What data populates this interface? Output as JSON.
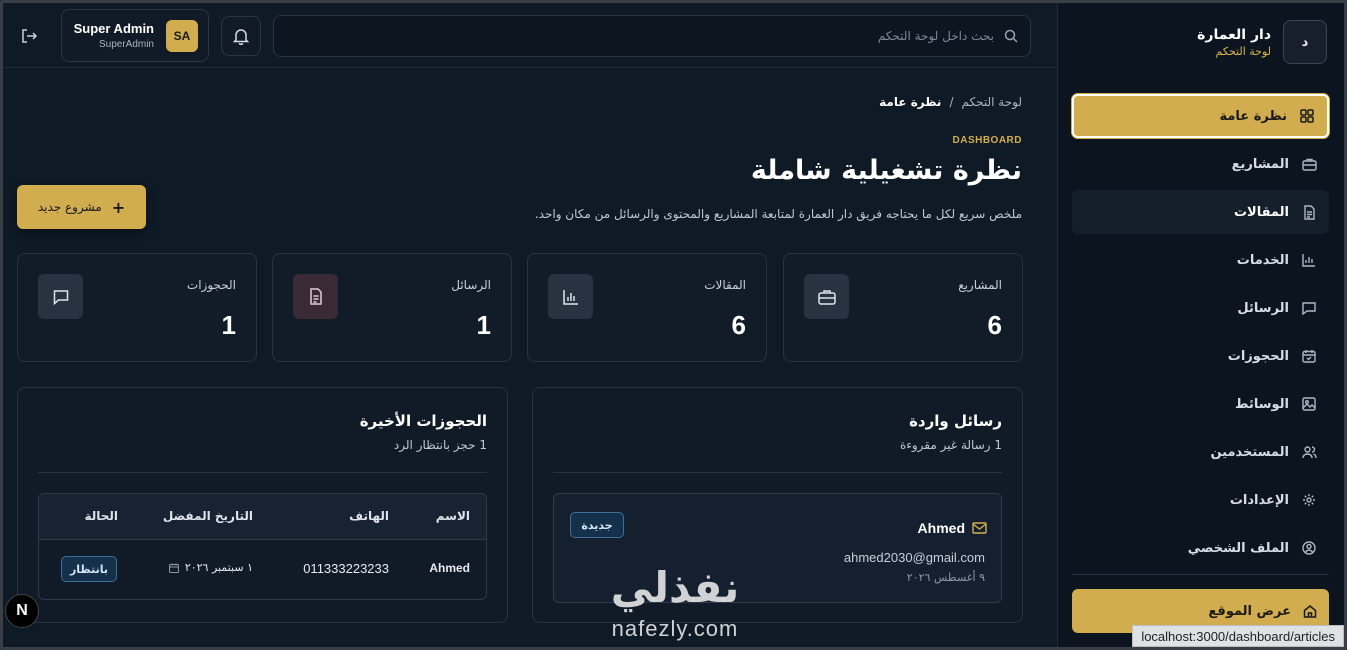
{
  "brand": {
    "title": "دار العمارة",
    "subtitle": "لوحة التحكم",
    "logo_letter": "د"
  },
  "sidebar": {
    "items": [
      {
        "label": "نظرة عامة",
        "icon": "grid-icon",
        "state": "active"
      },
      {
        "label": "المشاريع",
        "icon": "briefcase-icon"
      },
      {
        "label": "المقالات",
        "icon": "file-text-icon",
        "state": "hover"
      },
      {
        "label": "الخدمات",
        "icon": "bar-chart-icon"
      },
      {
        "label": "الرسائل",
        "icon": "message-square-icon"
      },
      {
        "label": "الحجوزات",
        "icon": "calendar-icon"
      },
      {
        "label": "الوسائط",
        "icon": "image-icon"
      },
      {
        "label": "المستخدمين",
        "icon": "users-icon"
      },
      {
        "label": "الإعدادات",
        "icon": "settings-icon"
      },
      {
        "label": "الملف الشخصي",
        "icon": "user-circle-icon"
      }
    ],
    "view_site_label": "عرض الموقع"
  },
  "topbar": {
    "search_placeholder": "بحث داخل لوحة التحكم",
    "user": {
      "name": "Super Admin",
      "role": "SuperAdmin",
      "initials": "SA"
    }
  },
  "breadcrumb": {
    "root": "لوحة التحكم",
    "separator": "/",
    "current": "نظرة عامة"
  },
  "header": {
    "eyebrow": "DASHBOARD",
    "title": "نظرة تشغيلية شاملة",
    "subtitle": "ملخص سريع لكل ما يحتاجه فريق دار العمارة لمتابعة المشاريع والمحتوى والرسائل من مكان واحد.",
    "new_project_label": "مشروع جديد"
  },
  "stats": [
    {
      "label": "المشاريع",
      "value": "6",
      "icon": "briefcase-icon"
    },
    {
      "label": "المقالات",
      "value": "6",
      "icon": "bar-chart-icon"
    },
    {
      "label": "الرسائل",
      "value": "1",
      "icon": "file-text-icon"
    },
    {
      "label": "الحجوزات",
      "value": "1",
      "icon": "message-square-icon"
    }
  ],
  "messages_panel": {
    "title": "رسائل واردة",
    "subtitle": "1 رسالة غير مقروءة",
    "message": {
      "name": "Ahmed",
      "email": "ahmed2030@gmail.com",
      "date": "٩ أغسطس ٢٠٢٦",
      "badge": "جديدة"
    }
  },
  "bookings_panel": {
    "title": "الحجوزات الأخيرة",
    "subtitle": "1 حجز بانتظار الرد",
    "columns": [
      "الاسم",
      "الهاتف",
      "التاريخ المفضل",
      "الحالة"
    ],
    "rows": [
      {
        "name": "Ahmed",
        "phone": "011333223233",
        "date": "١ سبتمبر ٢٠٢٦",
        "status": "بانتظار"
      }
    ]
  },
  "overlay": {
    "watermark_ar": "نفذلي",
    "watermark_en": "nafezly.com",
    "status_url": "localhost:3000/dashboard/articles",
    "next_badge": "N"
  },
  "colors": {
    "accent": "#d2ad4f",
    "background": "#0f1a27",
    "panel": "#111b28"
  }
}
